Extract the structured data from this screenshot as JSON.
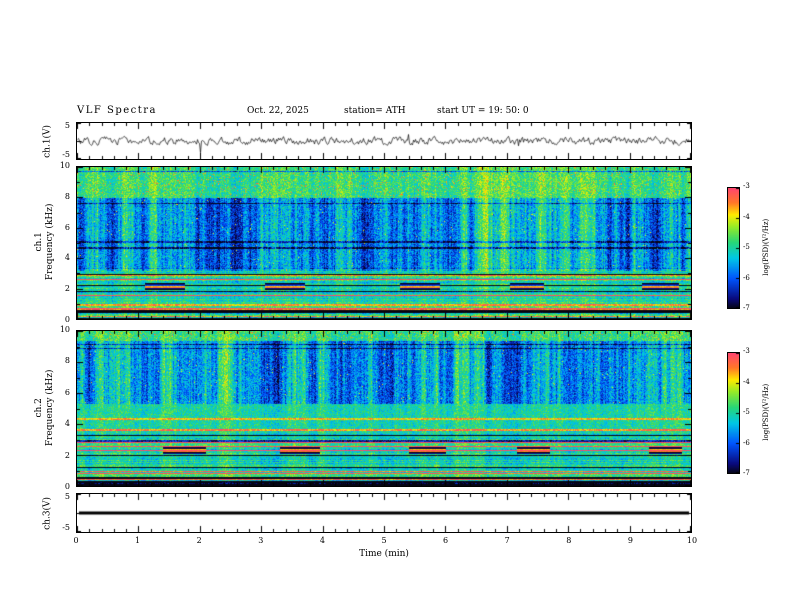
{
  "header": {
    "title": "VLF  Spectra",
    "date": "Oct. 22, 2025",
    "station": "station= ATH",
    "start_ut": "start UT =   19: 50: 0"
  },
  "xaxis": {
    "label": "Time  (min)",
    "ticks": [
      "0",
      "1",
      "2",
      "3",
      "4",
      "5",
      "6",
      "7",
      "8",
      "9",
      "10"
    ]
  },
  "panels": {
    "wave1": {
      "ylabel": "ch.1(V)",
      "yticks": [
        "5",
        "-5"
      ]
    },
    "spec1": {
      "ylabel_channel": "ch.1",
      "ylabel_axis": "Frequency  (kHz)",
      "yticks": [
        "10",
        "8",
        "6",
        "4",
        "2",
        "0"
      ]
    },
    "spec2": {
      "ylabel_channel": "ch.2",
      "ylabel_axis": "Frequency  (kHz)",
      "yticks": [
        "10",
        "8",
        "6",
        "4",
        "2",
        "0"
      ]
    },
    "wave3": {
      "ylabel": "ch.3(V)",
      "yticks": [
        "5",
        "-5"
      ]
    }
  },
  "colorbar": {
    "label": "log(PSD)(V²/Hz)",
    "ticks": [
      "-3",
      "-4",
      "-5",
      "-6",
      "-7"
    ]
  },
  "chart_data": [
    {
      "type": "line",
      "name": "ch1_waveform",
      "ylabel": "ch.1(V)",
      "ylim": [
        -5,
        5
      ],
      "xlim_min": [
        0,
        10
      ],
      "summary": "zero-mean broadband noise, mostly within ±1.5 V, frequent narrow spikes to about ±3 V"
    },
    {
      "type": "heatmap",
      "name": "ch1_spectrogram",
      "xlabel": "Time (min)",
      "ylabel": "Frequency (kHz)",
      "xlim": [
        0,
        10
      ],
      "ylim": [
        0,
        10
      ],
      "zlabel": "log(PSD)(V²/Hz)",
      "zlim": [
        -7,
        -3
      ],
      "structure": {
        "top_band_khz": [
          8,
          10
        ],
        "top_band_level": -4.75,
        "blue_zone_khz": [
          3.2,
          8
        ],
        "blue_zone_level": -5.6,
        "green_zone_level": -5.0,
        "dark_red_band_khz": [
          1.95,
          2.4
        ],
        "dark_red_band_level": -3.3,
        "dark_red_band_intervals_min": [
          [
            1.1,
            1.75
          ],
          [
            3.05,
            3.7
          ],
          [
            5.25,
            5.9
          ],
          [
            7.05,
            7.6
          ],
          [
            9.2,
            9.8
          ]
        ],
        "horizontal_lines": [
          {
            "f": 4.7,
            "off": -1.2
          },
          {
            "f": 5.05,
            "off": -1.0
          },
          {
            "f": 0.9,
            "off": 1.4
          },
          {
            "f": 0.5,
            "off": -2.6
          }
        ]
      }
    },
    {
      "type": "heatmap",
      "name": "ch2_spectrogram",
      "xlabel": "Time (min)",
      "ylabel": "Frequency (kHz)",
      "xlim": [
        0,
        10
      ],
      "ylim": [
        0,
        10
      ],
      "zlabel": "log(PSD)(V²/Hz)",
      "zlim": [
        -7,
        -3
      ],
      "structure": {
        "top_band_khz": [
          9.4,
          10
        ],
        "top_band_level": -4.8,
        "blue_zone_khz": [
          5.3,
          9.4
        ],
        "blue_zone_level": -5.6,
        "green_zone_level": -5.0,
        "dark_red_band_khz": [
          2.1,
          2.55
        ],
        "dark_red_band_level": -3.3,
        "dark_red_band_intervals_min": [
          [
            1.4,
            2.1
          ],
          [
            3.3,
            3.95
          ],
          [
            5.4,
            6.0
          ],
          [
            7.15,
            7.7
          ],
          [
            9.3,
            9.85
          ]
        ],
        "horizontal_lines": [
          {
            "f": 4.35,
            "off": 1.2
          },
          {
            "f": 3.6,
            "off": 1.5
          },
          {
            "f": 2.9,
            "off": -1.5
          },
          {
            "f": 0.5,
            "off": -2.6
          }
        ]
      }
    },
    {
      "type": "line",
      "name": "ch3_waveform",
      "ylabel": "ch.3(V)",
      "ylim": [
        -5,
        5
      ],
      "values_constant": 0,
      "summary": "flat thick line at 0 V (no signal)"
    }
  ]
}
